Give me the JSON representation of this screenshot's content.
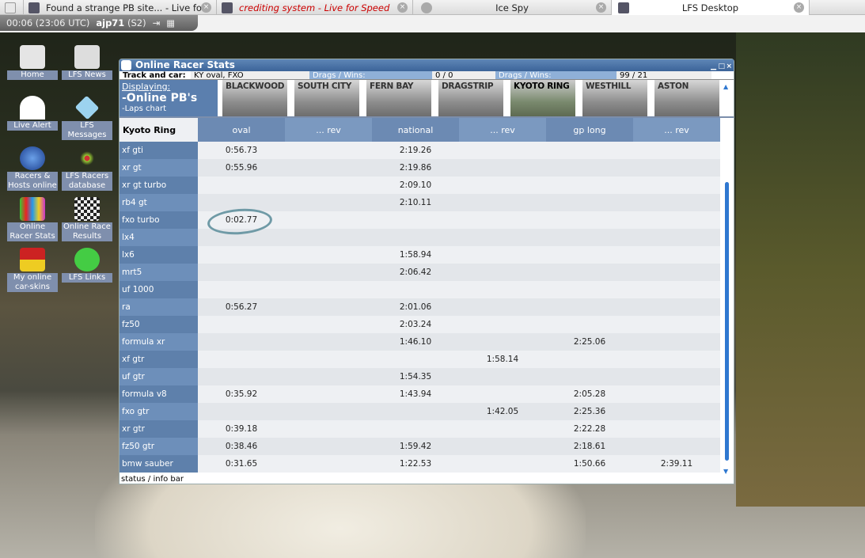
{
  "browser": {
    "tabs": [
      {
        "title": "Found a strange PB site... - Live fo...",
        "active": false
      },
      {
        "title": "crediting system - Live for Speed",
        "active": false
      },
      {
        "title": "Ice Spy",
        "active": false
      },
      {
        "title": "LFS Desktop",
        "active": true
      }
    ],
    "status": {
      "time": "00:06 (23:06 UTC)",
      "user": "ajp71",
      "server": "(S2)"
    }
  },
  "desktop": {
    "icons": [
      "Home",
      "LFS News",
      "Live Alert",
      "LFS Messages",
      "Racers & Hosts online",
      "LFS Racers database",
      "Online Racer Stats",
      "Online Race Results",
      "My online car-skins",
      "LFS Links"
    ]
  },
  "window": {
    "title": "Online Racer Stats",
    "info": {
      "track_label": "Track and car:",
      "track_value": "KY oval, FXO",
      "drags1_label": "Drags / Wins:",
      "drags1_value": "0 / 0",
      "drags2_label": "Drags / Wins:",
      "drags2_value": "99 / 21"
    },
    "displaying": {
      "label": "Displaying:",
      "mode": "-Online PB's",
      "sub": "-Laps chart"
    },
    "tracks": [
      "BLACKWOOD",
      "SOUTH CITY",
      "FERN BAY",
      "DRAGSTRIP",
      "KYOTO RING",
      "WESTHILL",
      "ASTON"
    ],
    "selected_track": "KYOTO RING",
    "table": {
      "corner": "Kyoto Ring",
      "columns": [
        "oval",
        "... rev",
        "national",
        "... rev",
        "gp long",
        "... rev"
      ],
      "rows": [
        {
          "car": "xf gti",
          "times": [
            "0:56.73",
            "",
            "2:19.26",
            "",
            "",
            ""
          ]
        },
        {
          "car": "xr gt",
          "times": [
            "0:55.96",
            "",
            "2:19.86",
            "",
            "",
            ""
          ]
        },
        {
          "car": "xr gt turbo",
          "times": [
            "",
            "",
            "2:09.10",
            "",
            "",
            ""
          ]
        },
        {
          "car": "rb4 gt",
          "times": [
            "",
            "",
            "2:10.11",
            "",
            "",
            ""
          ]
        },
        {
          "car": "fxo turbo",
          "times": [
            "0:02.77",
            "",
            "",
            "",
            "",
            ""
          ]
        },
        {
          "car": "lx4",
          "times": [
            "",
            "",
            "",
            "",
            "",
            ""
          ]
        },
        {
          "car": "lx6",
          "times": [
            "",
            "",
            "1:58.94",
            "",
            "",
            ""
          ]
        },
        {
          "car": "mrt5",
          "times": [
            "",
            "",
            "2:06.42",
            "",
            "",
            ""
          ]
        },
        {
          "car": "uf 1000",
          "times": [
            "",
            "",
            "",
            "",
            "",
            ""
          ]
        },
        {
          "car": "ra",
          "times": [
            "0:56.27",
            "",
            "2:01.06",
            "",
            "",
            ""
          ]
        },
        {
          "car": "fz50",
          "times": [
            "",
            "",
            "2:03.24",
            "",
            "",
            ""
          ]
        },
        {
          "car": "formula xr",
          "times": [
            "",
            "",
            "1:46.10",
            "",
            "2:25.06",
            ""
          ]
        },
        {
          "car": "xf gtr",
          "times": [
            "",
            "",
            "",
            "1:58.14",
            "",
            ""
          ]
        },
        {
          "car": "uf gtr",
          "times": [
            "",
            "",
            "1:54.35",
            "",
            "",
            ""
          ]
        },
        {
          "car": "formula v8",
          "times": [
            "0:35.92",
            "",
            "1:43.94",
            "",
            "2:05.28",
            ""
          ]
        },
        {
          "car": "fxo gtr",
          "times": [
            "",
            "",
            "",
            "1:42.05",
            "2:25.36",
            ""
          ]
        },
        {
          "car": "xr gtr",
          "times": [
            "0:39.18",
            "",
            "",
            "",
            "2:22.28",
            ""
          ]
        },
        {
          "car": "fz50 gtr",
          "times": [
            "0:38.46",
            "",
            "1:59.42",
            "",
            "2:18.61",
            ""
          ]
        },
        {
          "car": "bmw sauber",
          "times": [
            "0:31.65",
            "",
            "1:22.53",
            "",
            "1:50.66",
            "2:39.11"
          ]
        }
      ]
    },
    "status_bar": "status / info bar"
  }
}
